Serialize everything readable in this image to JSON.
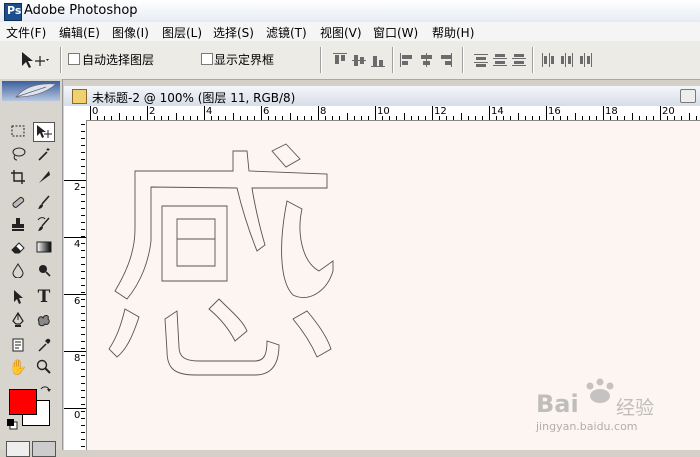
{
  "app": {
    "title": "Adobe Photoshop",
    "logo_text": "Ps"
  },
  "menu": [
    "文件(F)",
    "编辑(E)",
    "图像(I)",
    "图层(L)",
    "选择(S)",
    "滤镜(T)",
    "视图(V)",
    "窗口(W)",
    "帮助(H)"
  ],
  "options": {
    "auto_select_label": "自动选择图层",
    "show_bounds_label": "显示定界框",
    "auto_select_checked": false,
    "show_bounds_checked": false
  },
  "document": {
    "title": "未标题-2 @ 100% (图层 11, RGB/8)"
  },
  "ruler_h": [
    "0",
    "2",
    "4",
    "6",
    "8",
    "10",
    "12",
    "14",
    "16",
    "18",
    "20"
  ],
  "ruler_v": [
    "2",
    "4",
    "6",
    "8",
    "0"
  ],
  "colors": {
    "foreground": "#ff0000",
    "background": "#ffffff",
    "canvas": "#fdf5f1"
  },
  "watermark": {
    "brand": "Bai",
    "brand_suffix": "经验",
    "url": "jingyan.baidu.com"
  }
}
